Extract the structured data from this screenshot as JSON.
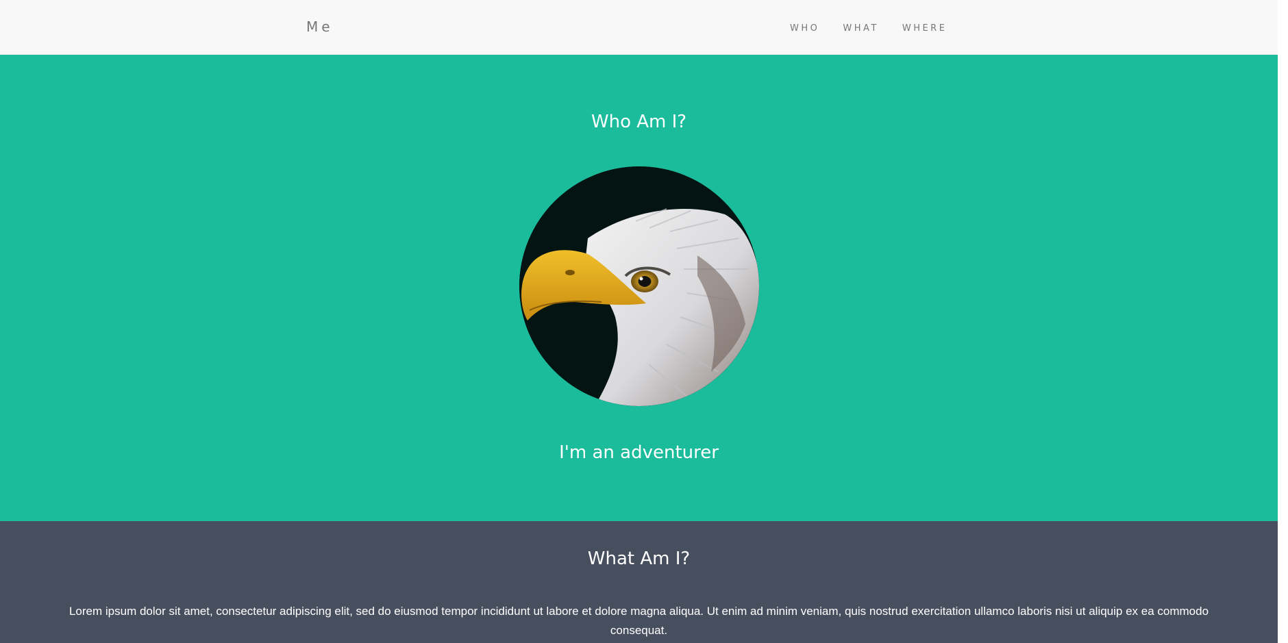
{
  "navbar": {
    "brand": "Me",
    "links": [
      "WHO",
      "WHAT",
      "WHERE"
    ]
  },
  "who": {
    "title": "Who Am I?",
    "avatar_alt": "bald-eagle-portrait",
    "subtitle": "I'm an adventurer"
  },
  "what": {
    "title": "What Am I?",
    "text": "Lorem ipsum dolor sit amet, consectetur adipiscing elit, sed do eiusmod tempor incididunt ut labore et dolore magna aliqua. Ut enim ad minim veniam, quis nostrud exercitation ullamco laboris nisi ut aliquip ex ea commodo consequat."
  },
  "colors": {
    "navbar_bg": "#f8f8f8",
    "who_bg": "#1abc9c",
    "what_bg": "#474e5d",
    "nav_text": "#777777"
  }
}
